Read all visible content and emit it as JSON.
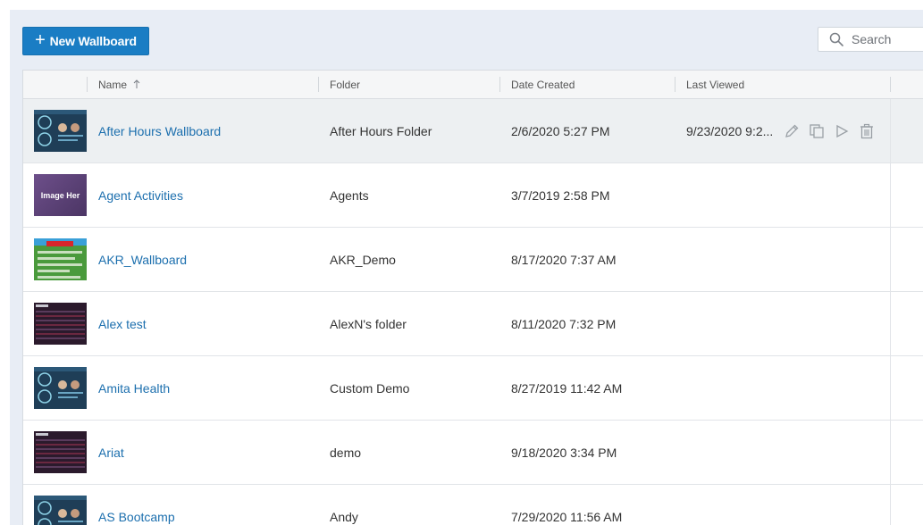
{
  "toolbar": {
    "new_button_label": "New Wallboard",
    "search_placeholder": "Search"
  },
  "columns": {
    "name": "Name",
    "folder": "Folder",
    "date_created": "Date Created",
    "last_viewed": "Last Viewed"
  },
  "thumbnail_labels": {
    "image_here": "Image Her"
  },
  "rows": [
    {
      "name": "After Hours Wallboard",
      "folder": "After Hours Folder",
      "date_created": "2/6/2020 5:27 PM",
      "last_viewed": "9/23/2020 9:2...",
      "thumbnail": "dashboard-dark",
      "selected": true
    },
    {
      "name": "Agent Activities",
      "folder": "Agents",
      "date_created": "3/7/2019 2:58 PM",
      "last_viewed": "",
      "thumbnail": "purple-image"
    },
    {
      "name": "AKR_Wallboard",
      "folder": "AKR_Demo",
      "date_created": "8/17/2020 7:37 AM",
      "last_viewed": "",
      "thumbnail": "green-field"
    },
    {
      "name": "Alex test",
      "folder": "AlexN's folder",
      "date_created": "8/11/2020 7:32 PM",
      "last_viewed": "",
      "thumbnail": "dark-table"
    },
    {
      "name": "Amita Health",
      "folder": "Custom Demo",
      "date_created": "8/27/2019 11:42 AM",
      "last_viewed": "",
      "thumbnail": "dashboard-dark"
    },
    {
      "name": "Ariat",
      "folder": "demo",
      "date_created": "9/18/2020 3:34 PM",
      "last_viewed": "",
      "thumbnail": "dark-table"
    },
    {
      "name": "AS Bootcamp",
      "folder": "Andy",
      "date_created": "7/29/2020 11:56 AM",
      "last_viewed": "",
      "thumbnail": "dashboard-dark"
    }
  ],
  "icons": {
    "search": "search-icon",
    "edit": "pencil-icon",
    "copy": "copy-icon",
    "play": "play-icon",
    "delete": "trash-icon"
  },
  "colors": {
    "accent": "#1a7dc4",
    "link": "#1c6fae",
    "background": "#e8edf5"
  }
}
